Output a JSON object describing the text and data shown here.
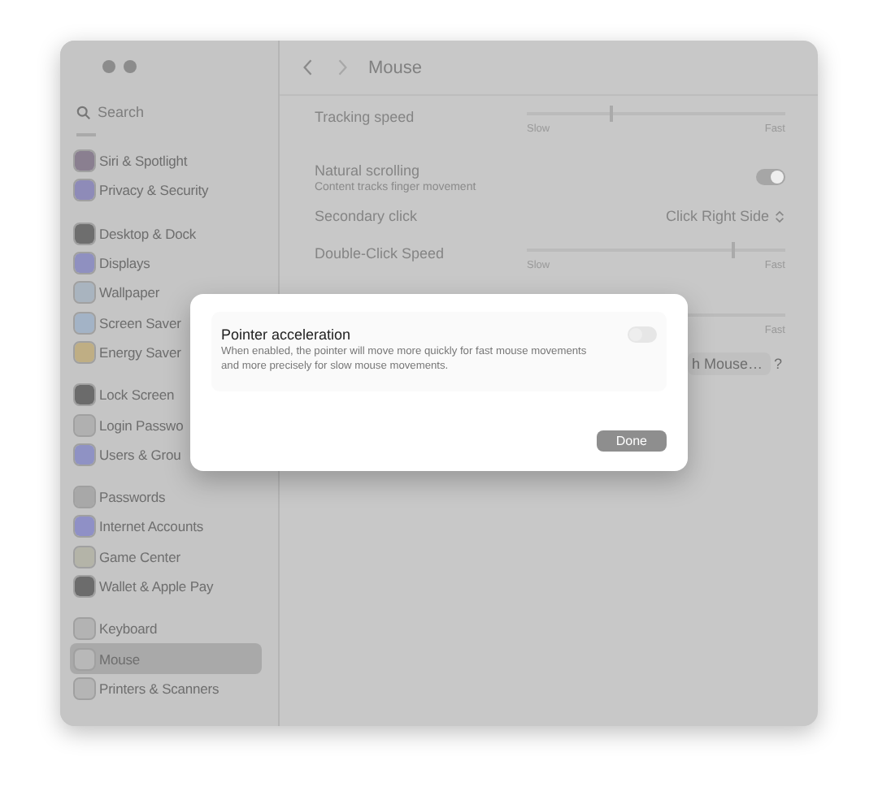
{
  "window": {
    "title": "Mouse"
  },
  "sidebar": {
    "search": {
      "placeholder": "Search"
    },
    "groups": [
      {
        "items": [
          {
            "label": "Siri & Spotlight",
            "color": "#8a7f90",
            "selected": false
          },
          {
            "label": "Privacy & Security",
            "color": "#8e8bb8",
            "selected": false
          }
        ]
      },
      {
        "items": [
          {
            "label": "Desktop & Dock",
            "color": "#6e6e6e",
            "selected": false
          },
          {
            "label": "Displays",
            "color": "#8f90c0",
            "selected": false
          },
          {
            "label": "Wallpaper",
            "color": "#a9b4bf",
            "selected": false
          },
          {
            "label": "Screen Saver",
            "color": "#a3b3c6",
            "selected": false
          },
          {
            "label": "Energy Saver",
            "color": "#bfae84",
            "selected": false
          }
        ]
      },
      {
        "items": [
          {
            "label": "Lock Screen",
            "color": "#6b6b6b",
            "selected": false
          },
          {
            "label": "Login Passwo",
            "color": "#b0b0b0",
            "selected": false
          },
          {
            "label": "Users & Grou",
            "color": "#8f92c4",
            "selected": false
          }
        ]
      },
      {
        "items": [
          {
            "label": "Passwords",
            "color": "#a8a8a8",
            "selected": false
          },
          {
            "label": "Internet Accounts",
            "color": "#8f90c6",
            "selected": false
          },
          {
            "label": "Game Center",
            "color": "#b4b4a8",
            "selected": false
          },
          {
            "label": "Wallet & Apple Pay",
            "color": "#6c6c6c",
            "selected": false
          }
        ]
      },
      {
        "items": [
          {
            "label": "Keyboard",
            "color": "#b3b3b3",
            "selected": false
          },
          {
            "label": "Mouse",
            "color": "#b8b8b8",
            "selected": true
          },
          {
            "label": "Printers & Scanners",
            "color": "#b5b5b5",
            "selected": false
          }
        ]
      }
    ]
  },
  "settings": [
    {
      "kind": "slider",
      "label": "Tracking speed",
      "level": 0.33,
      "min_label": "Slow",
      "max_label": "Fast"
    },
    {
      "kind": "toggle",
      "label": "Natural scrolling",
      "description": "Content tracks finger movement",
      "on": true
    },
    {
      "kind": "popup",
      "label": "Secondary click",
      "value": "Click Right Side"
    },
    {
      "kind": "slider",
      "label": "Double-Click Speed",
      "level": 0.8,
      "min_label": "Slow",
      "max_label": "Fast"
    }
  ],
  "hidden_row": {
    "max_label": "Fast"
  },
  "footer": {
    "button": "h Mouse…",
    "help": "?"
  },
  "dialog": {
    "title": "Pointer acceleration",
    "description": "When enabled, the pointer will move more quickly for fast mouse movements and more precisely for slow mouse movements.",
    "on": false,
    "button": "Done"
  }
}
